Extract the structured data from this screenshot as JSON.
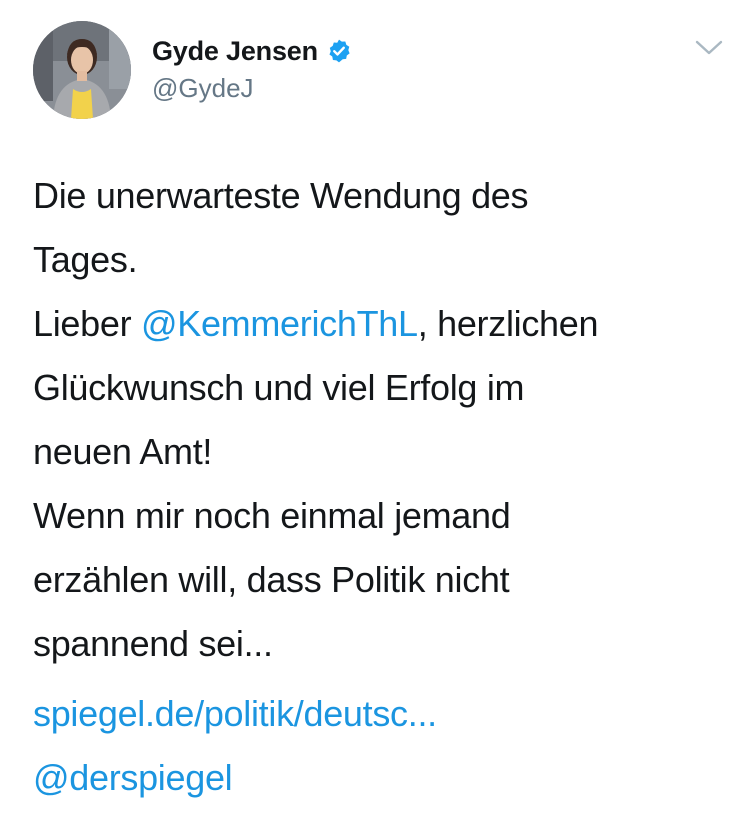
{
  "author": {
    "display_name": "Gyde Jensen",
    "handle": "@GydeJ",
    "verified": true
  },
  "icons": {
    "verified": "verified-badge-icon",
    "menu": "chevron-down-icon",
    "accent_color": "#1b95e0",
    "secondary_text_color": "#657786"
  },
  "tweet": {
    "lines": [
      {
        "text": "Die unerwarteste Wendung des"
      },
      {
        "text": "Tages."
      },
      {
        "before": "Lieber ",
        "mention": "@KemmerichThL",
        "after": ", herzlichen"
      },
      {
        "text": "Glückwunsch und viel Erfolg im"
      },
      {
        "text": "neuen Amt!"
      },
      {
        "text": "Wenn mir noch einmal jemand"
      },
      {
        "text": "erzählen will, dass Politik nicht"
      },
      {
        "text": "spannend sei..."
      }
    ],
    "link_url_text": "spiegel.de/politik/deutsc...",
    "via_mention": "@derspiegel"
  }
}
